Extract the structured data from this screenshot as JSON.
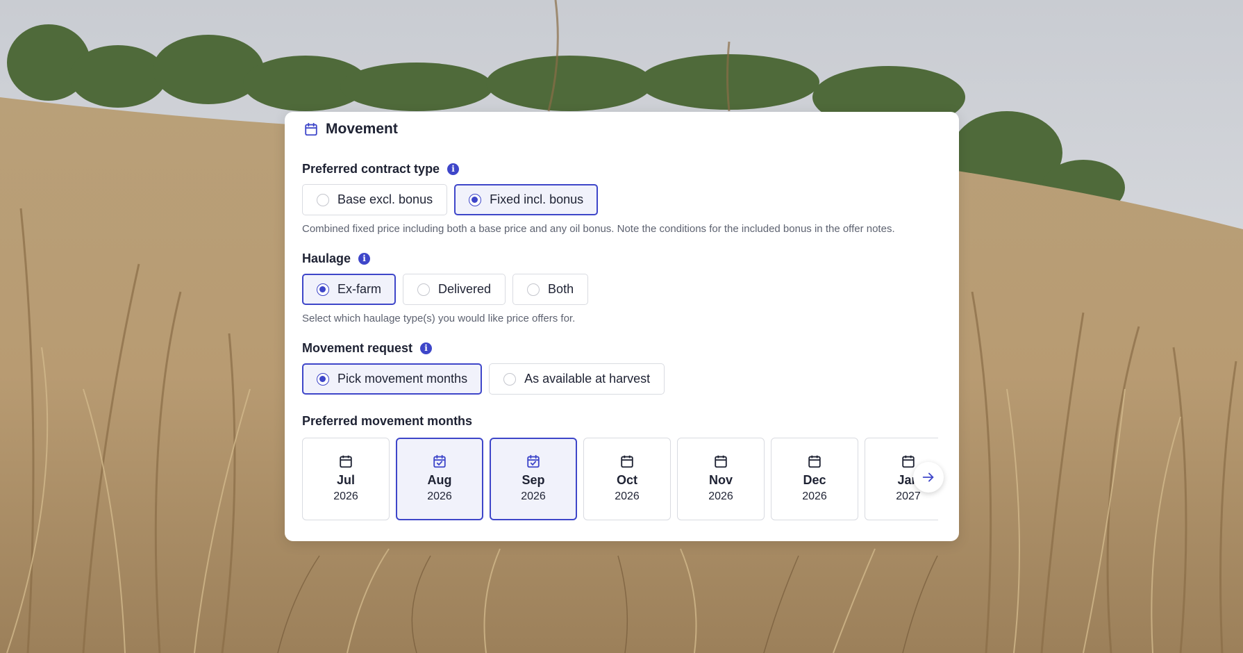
{
  "card": {
    "title": "Movement",
    "header_icon": "calendar-icon"
  },
  "contract_type": {
    "label": "Preferred contract type",
    "options": [
      {
        "label": "Base excl. bonus",
        "selected": false
      },
      {
        "label": "Fixed incl. bonus",
        "selected": true
      }
    ],
    "help": "Combined fixed price including both a base price and any oil bonus. Note the conditions for the included bonus in the offer notes."
  },
  "haulage": {
    "label": "Haulage",
    "options": [
      {
        "label": "Ex-farm",
        "selected": true
      },
      {
        "label": "Delivered",
        "selected": false
      },
      {
        "label": "Both",
        "selected": false
      }
    ],
    "help": "Select which haulage type(s) you would like price offers for."
  },
  "movement_request": {
    "label": "Movement request",
    "options": [
      {
        "label": "Pick movement months",
        "selected": true
      },
      {
        "label": "As available at harvest",
        "selected": false
      }
    ]
  },
  "months": {
    "label": "Preferred movement months",
    "items": [
      {
        "month": "Jul",
        "year": "2026",
        "selected": false
      },
      {
        "month": "Aug",
        "year": "2026",
        "selected": true
      },
      {
        "month": "Sep",
        "year": "2026",
        "selected": true
      },
      {
        "month": "Oct",
        "year": "2026",
        "selected": false
      },
      {
        "month": "Nov",
        "year": "2026",
        "selected": false
      },
      {
        "month": "Dec",
        "year": "2026",
        "selected": false
      },
      {
        "month": "Jan",
        "year": "2027",
        "selected": false
      }
    ],
    "next_icon": "arrow-right-icon"
  },
  "info_glyph": "i",
  "colors": {
    "accent": "#3e46c9",
    "selected_bg": "#f1f2fb",
    "border": "#d9dbe1",
    "text": "#1e2233",
    "muted": "#5d6270"
  }
}
